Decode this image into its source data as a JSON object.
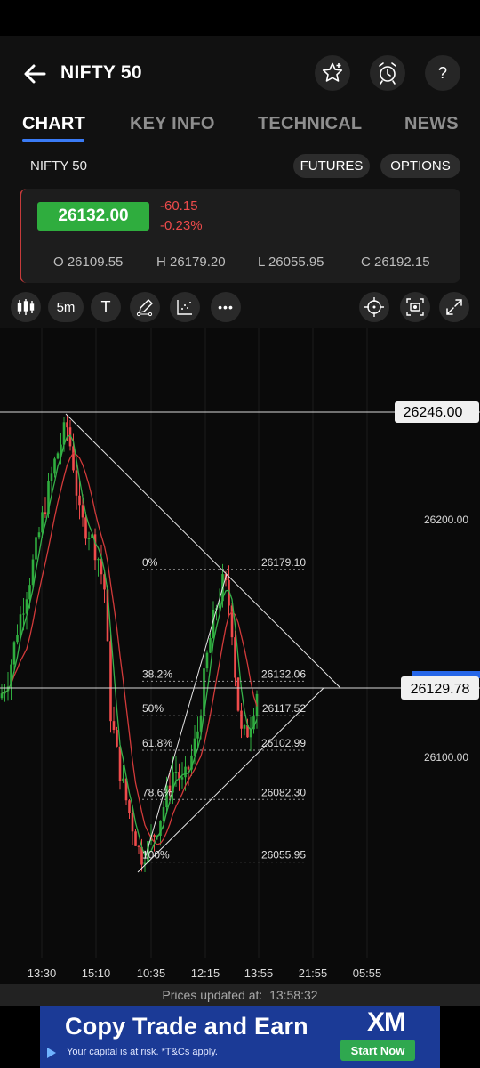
{
  "header": {
    "title": "NIFTY 50"
  },
  "tabs": [
    {
      "label": "CHART",
      "active": true
    },
    {
      "label": "KEY INFO",
      "active": false
    },
    {
      "label": "TECHNICAL",
      "active": false
    },
    {
      "label": "NEWS",
      "active": false
    }
  ],
  "instrument": {
    "name": "NIFTY 50",
    "futures_label": "FUTURES",
    "options_label": "OPTIONS"
  },
  "quote": {
    "price": "26132.00",
    "change": "-60.15",
    "change_pct": "-0.23%",
    "open": "O 26109.55",
    "high": "H 26179.20",
    "low": "L 26055.95",
    "close": "C 26192.15",
    "up_color": "#2fad3e",
    "down_color": "#ef4b4b"
  },
  "toolbar": {
    "interval": "5m",
    "text_tool": "T",
    "more": "•••",
    "icons": [
      "candles-icon",
      "pen-icon",
      "indicators-icon",
      "crosshair-icon",
      "screenshot-icon",
      "expand-icon"
    ]
  },
  "chart": {
    "y_labels": [
      "26200.00",
      "26100.00"
    ],
    "x_labels": [
      "13:30",
      "15:10",
      "10:35",
      "12:15",
      "13:55",
      "21:55",
      "05:55"
    ],
    "high_line_label": "26246.00",
    "current_price_label": "26129.78",
    "fib_levels": [
      {
        "pct": "0%",
        "price": "26179.10"
      },
      {
        "pct": "38.2%",
        "price": "26132.06"
      },
      {
        "pct": "50%",
        "price": "26117.52"
      },
      {
        "pct": "61.8%",
        "price": "26102.99"
      },
      {
        "pct": "78.6%",
        "price": "26082.30"
      },
      {
        "pct": "100%",
        "price": "26055.95"
      }
    ]
  },
  "footer": {
    "updated_label": "Prices updated at:",
    "updated_time": "13:58:32"
  },
  "ad": {
    "title": "Copy Trade and Earn",
    "subtitle": "Your capital is at risk. *T&Cs apply.",
    "brand": "XM",
    "cta": "Start Now"
  }
}
